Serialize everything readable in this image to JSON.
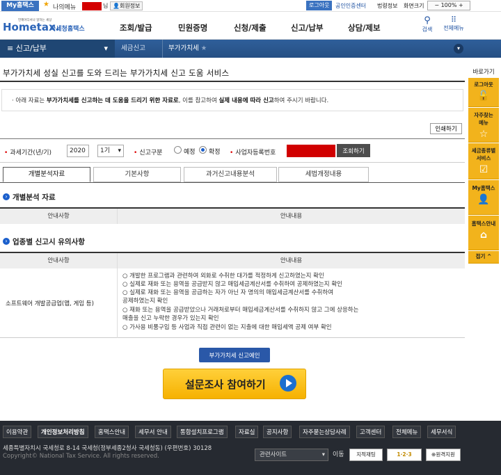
{
  "top_bar": {
    "my_tax": "My홈택스",
    "my_menu": "나의메뉴",
    "suffix": "님",
    "member_info": "회원정보",
    "logout": "로그아웃",
    "cert_center": "공인인증센터",
    "law_info": "법령정보",
    "font_size": "화면크기",
    "zoom": "100%"
  },
  "header": {
    "logo_small": "언제어디서나 일하는 세상",
    "logo": "Hometax.",
    "logo_suffix": "국세청홈택스",
    "nav": [
      "조회/발급",
      "민원증명",
      "신청/제출",
      "신고/납부",
      "상담/제보"
    ],
    "search_label": "검색",
    "all_menu_label": "전체메뉴"
  },
  "breadcrumb": {
    "menu": "신고/납부",
    "level1": "세금신고",
    "level2": "부가가치세"
  },
  "page": {
    "title": "부가가치세 성실 신고를 도와 드리는 부가가치세 신고 도움 서비스",
    "notice_prefix": "· 아래 자료는 ",
    "notice_bold1": "부가가치세를 신고하는 데 도움을 드리기 위한 자료로",
    "notice_mid": ", 이를 참고하여 ",
    "notice_bold2": "실제 내용에 따라 신고",
    "notice_suffix": "하여 주시기 바랍니다.",
    "print": "인쇄하기"
  },
  "filter": {
    "period_label": "과세기간(년/기)",
    "year": "2020",
    "term": "1기",
    "type_label": "신고구분",
    "opt_prelim": "예정",
    "opt_final": "확정",
    "biz_label": "사업자등록번호",
    "inquiry": "조회하기"
  },
  "tabs": [
    "개별분석자료",
    "기본사항",
    "과거신고내용분석",
    "세법개정내용"
  ],
  "section1": {
    "title": "개별분석 자료",
    "col1": "안내사항",
    "col2": "안내내용"
  },
  "section2": {
    "title": "업종별 신고시 유의사항",
    "col1": "안내사항",
    "col2": "안내내용",
    "row_name": "소프트웨어 개발공급업(앱, 게임 등)",
    "items": [
      "○ 개발한 프로그램과 관련하여 외화로 수취한 대가를 적정하게 신고하였는지 확인",
      "○ 실제로 재화 또는 용역을 공급받지 않고 매입세금계산서를 수취하여 공제하였는지 확인",
      "○ 실제로 재화 또는 용역을 공급하는 자가 아닌 자 명의의 매입세금계산서를 수취하여",
      "공제하였는지 확인",
      "○ 재화 또는 용역을 공급받았으나 거래처로부터 매입세금계산서를 수취하지 않고 그에 상응하는",
      "매출을 신고 누락한 경우가 있는지 확인",
      "○ 가사용 비품구입 등 사업과 직접 관련이 없는 지출에 대한 매입세액 공제 여부 확인"
    ]
  },
  "buttons": {
    "help": "부가가치세 신고예인",
    "survey": "설문조사 참여하기"
  },
  "quick": {
    "title": "바로가기",
    "items": [
      "로그아웃",
      "자주찾는 메뉴",
      "세금종류별 서비스",
      "My홈택스",
      "홈택스안내",
      "접기 ^"
    ]
  },
  "footer": {
    "links": [
      "이용약관",
      "개인정보처리방침",
      "홈택스안내",
      "세무서 안내",
      "통합설치프로그램",
      "자료실",
      "공지사항",
      "자주묻는상담사례",
      "고객센터",
      "전체메뉴",
      "세무서식"
    ],
    "address": "세종특별자치시 국세청로 8-14 국세청(정부세종2청사 국세청동) (우편번호) 30128",
    "copyright": "Copyright© National Tax Service. All rights reserved.",
    "related_site": "관련사이트",
    "go": "이동",
    "badges": [
      "지적재팅",
      "",
      "원격지원"
    ]
  },
  "colors": {
    "brand_blue": "#2f5f9a",
    "accent_yellow": "#f2b31c",
    "redaction": "#d10000"
  }
}
